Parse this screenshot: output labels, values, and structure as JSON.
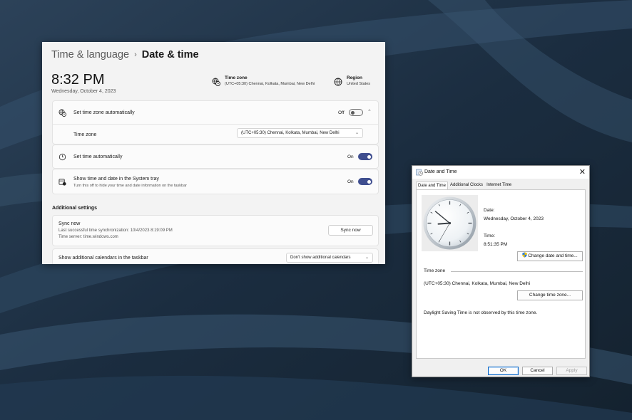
{
  "settings": {
    "breadcrumb": {
      "parent": "Time & language",
      "separator": "›",
      "current": "Date & time"
    },
    "current_time": "8:32 PM",
    "current_date": "Wednesday, October 4, 2023",
    "time_zone_summary": {
      "label": "Time zone",
      "value": "(UTC+05:30) Chennai, Kolkata, Mumbai, New Delhi"
    },
    "region_summary": {
      "label": "Region",
      "value": "United States"
    },
    "set_time_zone_auto": {
      "label": "Set time zone automatically",
      "state": "Off"
    },
    "time_zone_row": {
      "label": "Time zone",
      "value": "(UTC+05:30) Chennai, Kolkata, Mumbai, New Delhi"
    },
    "set_time_auto": {
      "label": "Set time automatically",
      "state": "On"
    },
    "show_in_tray": {
      "label": "Show time and date in the System tray",
      "description": "Turn this off to hide your time and date information on the taskbar",
      "state": "On"
    },
    "additional_settings_heading": "Additional settings",
    "sync": {
      "title": "Sync now",
      "last_sync": "Last successful time synchronization: 10/4/2023 8:19:09 PM",
      "server": "Time server: time.windows.com",
      "button": "Sync now"
    },
    "calendars": {
      "label": "Show additional calendars in the taskbar",
      "value": "Don't show additional calendars"
    },
    "colors": {
      "accent": "#3f4e8f",
      "background": "#f3f3f3",
      "card": "#fbfbfb"
    }
  },
  "dialog": {
    "title": "Date and Time",
    "close_glyph": "✕",
    "tabs": [
      "Date and Time",
      "Additional Clocks",
      "Internet Time"
    ],
    "active_tab": 0,
    "date_label": "Date:",
    "date_value": "Wednesday, October 4, 2023",
    "time_label": "Time:",
    "time_value": "8:51:35 PM",
    "analog_clock": {
      "hour": 8,
      "minute": 51,
      "second": 35
    },
    "change_datetime_button": "Change date and time...",
    "time_zone_heading": "Time zone",
    "time_zone_value": "(UTC+05:30) Chennai, Kolkata, Mumbai, New Delhi",
    "change_timezone_button": "Change time zone...",
    "dst_note": "Daylight Saving Time is not observed by this time zone.",
    "ok_button": "OK",
    "cancel_button": "Cancel",
    "apply_button": "Apply"
  },
  "icons": {
    "timezone_sync": "globe-clock-icon",
    "region": "globe-icon",
    "clock": "clock-icon",
    "calendar_tray": "calendar-clock-icon",
    "dialog_app": "date-time-app-icon",
    "uac_shield": "uac-shield-icon"
  }
}
